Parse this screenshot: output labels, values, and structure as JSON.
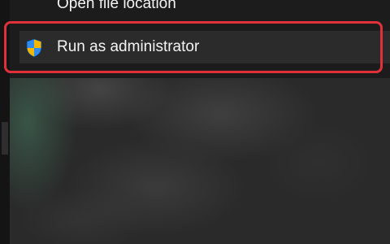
{
  "context_menu": {
    "items": [
      {
        "label": "Open file location",
        "icon": ""
      },
      {
        "label": "Run as administrator",
        "icon": "uac-shield-icon"
      }
    ],
    "highlighted_item": "Run as administrator"
  },
  "colors": {
    "highlight_border": "#e0313b",
    "menu_background": "#1c1c1c",
    "text": "#f3f3f3",
    "shield_blue": "#1e73d8",
    "shield_yellow": "#f2b705"
  }
}
